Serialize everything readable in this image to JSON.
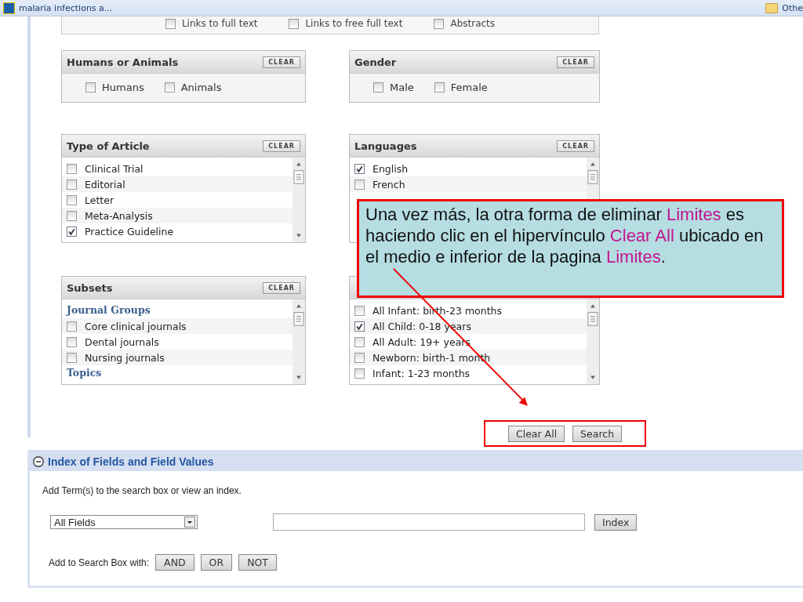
{
  "browser_bar": {
    "tab_title": "malaria infections a...",
    "bookmark": "Othe"
  },
  "top_filters": [
    {
      "label": "Links to full text",
      "checked": false
    },
    {
      "label": "Links to free full text",
      "checked": false
    },
    {
      "label": "Abstracts",
      "checked": false
    }
  ],
  "filter_boxes": [
    {
      "title": "Humans or Animals",
      "clear": "CLEAR",
      "kind": "inline",
      "items": [
        {
          "label": "Humans",
          "checked": false
        },
        {
          "label": "Animals",
          "checked": false
        }
      ]
    },
    {
      "title": "Gender",
      "clear": "CLEAR",
      "kind": "inline",
      "items": [
        {
          "label": "Male",
          "checked": false
        },
        {
          "label": "Female",
          "checked": false
        }
      ]
    },
    {
      "title": "Type of Article",
      "clear": "CLEAR",
      "kind": "list",
      "items": [
        {
          "kind": "option",
          "label": "Clinical Trial",
          "checked": false
        },
        {
          "kind": "option",
          "label": "Editorial",
          "checked": false
        },
        {
          "kind": "option",
          "label": "Letter",
          "checked": false
        },
        {
          "kind": "option",
          "label": "Meta-Analysis",
          "checked": false
        },
        {
          "kind": "option",
          "label": "Practice Guideline",
          "checked": true
        }
      ]
    },
    {
      "title": "Languages",
      "clear": "CLEAR",
      "kind": "list",
      "items": [
        {
          "kind": "option",
          "label": "English",
          "checked": true
        },
        {
          "kind": "option",
          "label": "French",
          "checked": false
        }
      ]
    },
    {
      "title": "Subsets",
      "clear": "CLEAR",
      "kind": "list",
      "items": [
        {
          "kind": "heading",
          "label": "Journal Groups"
        },
        {
          "kind": "option",
          "label": "Core clinical journals",
          "checked": false
        },
        {
          "kind": "option",
          "label": "Dental journals",
          "checked": false
        },
        {
          "kind": "option",
          "label": "Nursing journals",
          "checked": false
        },
        {
          "kind": "heading",
          "label": "Topics"
        }
      ]
    },
    {
      "kind": "list",
      "items": [
        {
          "kind": "option",
          "label": "All Infant: birth-23 months",
          "checked": false
        },
        {
          "kind": "option",
          "label": "All Child: 0-18 years",
          "checked": true
        },
        {
          "kind": "option",
          "label": "All Adult: 19+ years",
          "checked": false
        },
        {
          "kind": "option",
          "label": "Newborn: birth-1 month",
          "checked": false
        },
        {
          "kind": "option",
          "label": "Infant: 1-23 months",
          "checked": false
        }
      ]
    }
  ],
  "actions": [
    "Clear All",
    "Search"
  ],
  "callout": [
    {
      "text": "Una vez más, la otra forma de eliminar ",
      "highlight": false
    },
    {
      "text": "Limites",
      "highlight": true
    },
    {
      "text": " es haciendo clic en el hipervínculo ",
      "highlight": false
    },
    {
      "text": "Clear All",
      "highlight": true
    },
    {
      "text": " ubicado en el medio e inferior de la pagina ",
      "highlight": false
    },
    {
      "text": "Limites",
      "highlight": true
    },
    {
      "text": ".",
      "highlight": false
    }
  ],
  "index_section": {
    "title": "Index of Fields and Field Values",
    "hint": "Add Term(s) to the search box or view an index.",
    "field_select": "All Fields",
    "index_button": "Index",
    "add_label": "Add to Search Box with:",
    "operators": [
      "AND",
      "OR",
      "NOT"
    ]
  }
}
